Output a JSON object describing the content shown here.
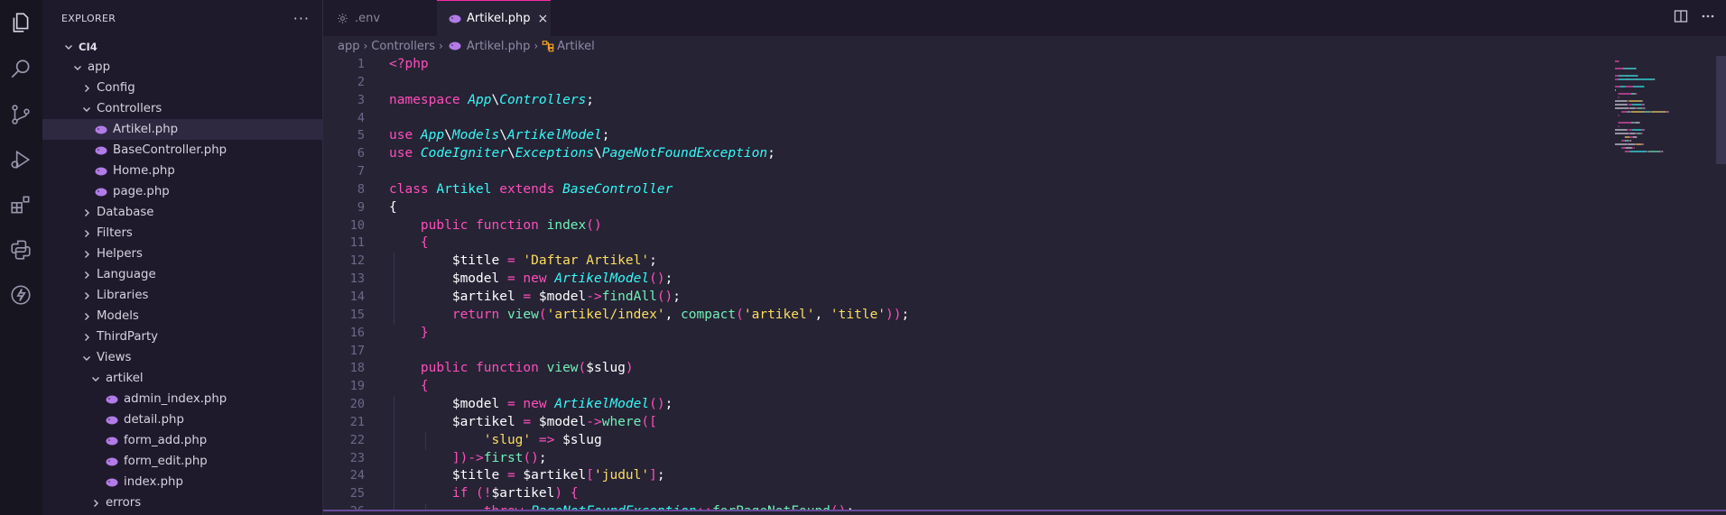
{
  "activity_bar": {
    "icons": [
      "files-icon",
      "search-icon",
      "source-control-icon",
      "run-debug-icon",
      "extensions-icon",
      "python-icon",
      "lightning-icon"
    ]
  },
  "explorer": {
    "title": "EXPLORER",
    "more": "···",
    "tree": [
      {
        "label": "CI4",
        "level": 0,
        "type": "root",
        "expanded": true
      },
      {
        "label": "app",
        "level": 1,
        "type": "folder",
        "expanded": true
      },
      {
        "label": "Config",
        "level": 2,
        "type": "folder",
        "expanded": false
      },
      {
        "label": "Controllers",
        "level": 2,
        "type": "folder",
        "expanded": true
      },
      {
        "label": "Artikel.php",
        "level": 3,
        "type": "php",
        "active": true
      },
      {
        "label": "BaseController.php",
        "level": 3,
        "type": "php"
      },
      {
        "label": "Home.php",
        "level": 3,
        "type": "php"
      },
      {
        "label": "page.php",
        "level": 3,
        "type": "php"
      },
      {
        "label": "Database",
        "level": 2,
        "type": "folder",
        "expanded": false
      },
      {
        "label": "Filters",
        "level": 2,
        "type": "folder",
        "expanded": false
      },
      {
        "label": "Helpers",
        "level": 2,
        "type": "folder",
        "expanded": false
      },
      {
        "label": "Language",
        "level": 2,
        "type": "folder",
        "expanded": false
      },
      {
        "label": "Libraries",
        "level": 2,
        "type": "folder",
        "expanded": false
      },
      {
        "label": "Models",
        "level": 2,
        "type": "folder",
        "expanded": false
      },
      {
        "label": "ThirdParty",
        "level": 2,
        "type": "folder",
        "expanded": false
      },
      {
        "label": "Views",
        "level": 2,
        "type": "folder",
        "expanded": true
      },
      {
        "label": "artikel",
        "level": 3,
        "type": "folder",
        "expanded": true
      },
      {
        "label": "admin_index.php",
        "level": 4,
        "type": "php"
      },
      {
        "label": "detail.php",
        "level": 4,
        "type": "php"
      },
      {
        "label": "form_add.php",
        "level": 4,
        "type": "php"
      },
      {
        "label": "form_edit.php",
        "level": 4,
        "type": "php"
      },
      {
        "label": "index.php",
        "level": 4,
        "type": "php"
      },
      {
        "label": "errors",
        "level": 3,
        "type": "folder",
        "expanded": false
      }
    ]
  },
  "tabs": {
    "env_label": ".env",
    "active_label": "Artikel.php",
    "close_glyph": "×"
  },
  "breadcrumb": {
    "app": "app",
    "controllers": "Controllers",
    "file": "Artikel.php",
    "symbol": "Artikel"
  },
  "editor": {
    "lines": [
      [
        [
          "pk",
          "<?php"
        ]
      ],
      [],
      [
        [
          "pk",
          "namespace "
        ],
        [
          "nsi",
          "App"
        ],
        [
          "punc",
          "\\"
        ],
        [
          "nsi",
          "Controllers"
        ],
        [
          "punc",
          ";"
        ]
      ],
      [],
      [
        [
          "pk",
          "use "
        ],
        [
          "nsi",
          "App"
        ],
        [
          "punc",
          "\\"
        ],
        [
          "nsi",
          "Models"
        ],
        [
          "punc",
          "\\"
        ],
        [
          "nsi",
          "ArtikelModel"
        ],
        [
          "punc",
          ";"
        ]
      ],
      [
        [
          "pk",
          "use "
        ],
        [
          "nsi",
          "CodeIgniter"
        ],
        [
          "punc",
          "\\"
        ],
        [
          "nsi",
          "Exceptions"
        ],
        [
          "punc",
          "\\"
        ],
        [
          "nsi",
          "PageNotFoundException"
        ],
        [
          "punc",
          ";"
        ]
      ],
      [],
      [
        [
          "pk",
          "class "
        ],
        [
          "cls",
          "Artikel"
        ],
        [
          "pk",
          " extends "
        ],
        [
          "nsi",
          "BaseController"
        ]
      ],
      [
        [
          "punc",
          "{"
        ]
      ],
      [
        [
          "v",
          "    "
        ],
        [
          "pk",
          "public function "
        ],
        [
          "ns",
          "index"
        ],
        [
          "br",
          "()"
        ]
      ],
      [
        [
          "v",
          "    "
        ],
        [
          "br",
          "{"
        ]
      ],
      [
        [
          "v",
          "        $title "
        ],
        [
          "pk",
          "="
        ],
        [
          "v",
          " "
        ],
        [
          "str",
          "'Daftar Artikel'"
        ],
        [
          "punc",
          ";"
        ]
      ],
      [
        [
          "v",
          "        $model "
        ],
        [
          "pk",
          "="
        ],
        [
          "v",
          " "
        ],
        [
          "pk",
          "new "
        ],
        [
          "nsi",
          "ArtikelModel"
        ],
        [
          "br",
          "()"
        ],
        [
          "punc",
          ";"
        ]
      ],
      [
        [
          "v",
          "        $artikel "
        ],
        [
          "pk",
          "="
        ],
        [
          "v",
          " $model"
        ],
        [
          "pk",
          "->"
        ],
        [
          "ns",
          "findAll"
        ],
        [
          "br",
          "()"
        ],
        [
          "punc",
          ";"
        ]
      ],
      [
        [
          "v",
          "        "
        ],
        [
          "pk",
          "return "
        ],
        [
          "ns",
          "view"
        ],
        [
          "br",
          "("
        ],
        [
          "str",
          "'artikel/index'"
        ],
        [
          "punc",
          ", "
        ],
        [
          "ns",
          "compact"
        ],
        [
          "br",
          "("
        ],
        [
          "str",
          "'artikel'"
        ],
        [
          "punc",
          ", "
        ],
        [
          "str",
          "'title'"
        ],
        [
          "br",
          "))"
        ],
        [
          "punc",
          ";"
        ]
      ],
      [
        [
          "v",
          "    "
        ],
        [
          "br",
          "}"
        ]
      ],
      [],
      [
        [
          "v",
          "    "
        ],
        [
          "pk",
          "public function "
        ],
        [
          "ns",
          "view"
        ],
        [
          "br",
          "("
        ],
        [
          "v",
          "$slug"
        ],
        [
          "br",
          ")"
        ]
      ],
      [
        [
          "v",
          "    "
        ],
        [
          "br",
          "{"
        ]
      ],
      [
        [
          "v",
          "        $model "
        ],
        [
          "pk",
          "="
        ],
        [
          "v",
          " "
        ],
        [
          "pk",
          "new "
        ],
        [
          "nsi",
          "ArtikelModel"
        ],
        [
          "br",
          "()"
        ],
        [
          "punc",
          ";"
        ]
      ],
      [
        [
          "v",
          "        $artikel "
        ],
        [
          "pk",
          "="
        ],
        [
          "v",
          " $model"
        ],
        [
          "pk",
          "->"
        ],
        [
          "ns",
          "where"
        ],
        [
          "br",
          "(["
        ]
      ],
      [
        [
          "v",
          "            "
        ],
        [
          "str",
          "'slug'"
        ],
        [
          "pk",
          " => "
        ],
        [
          "v",
          "$slug"
        ]
      ],
      [
        [
          "v",
          "        "
        ],
        [
          "br",
          "])"
        ],
        [
          "pk",
          "->"
        ],
        [
          "ns",
          "first"
        ],
        [
          "br",
          "()"
        ],
        [
          "punc",
          ";"
        ]
      ],
      [
        [
          "v",
          "        $title "
        ],
        [
          "pk",
          "="
        ],
        [
          "v",
          " $artikel"
        ],
        [
          "br",
          "["
        ],
        [
          "str",
          "'judul'"
        ],
        [
          "br",
          "]"
        ],
        [
          "punc",
          ";"
        ]
      ],
      [
        [
          "v",
          "        "
        ],
        [
          "pk",
          "if "
        ],
        [
          "br",
          "("
        ],
        [
          "pk",
          "!"
        ],
        [
          "v",
          "$artikel"
        ],
        [
          "br",
          ")"
        ],
        [
          "v",
          " "
        ],
        [
          "br",
          "{"
        ]
      ],
      [
        [
          "v",
          "            "
        ],
        [
          "pk",
          "throw "
        ],
        [
          "nsi",
          "PageNotFoundException"
        ],
        [
          "pk",
          "::"
        ],
        [
          "ns",
          "forPageNotFound"
        ],
        [
          "br",
          "()"
        ],
        [
          "punc",
          ";"
        ]
      ]
    ]
  },
  "colors": {
    "background": "#262335",
    "sidebar": "#1e1a2b",
    "accent": "#fc28a8"
  }
}
